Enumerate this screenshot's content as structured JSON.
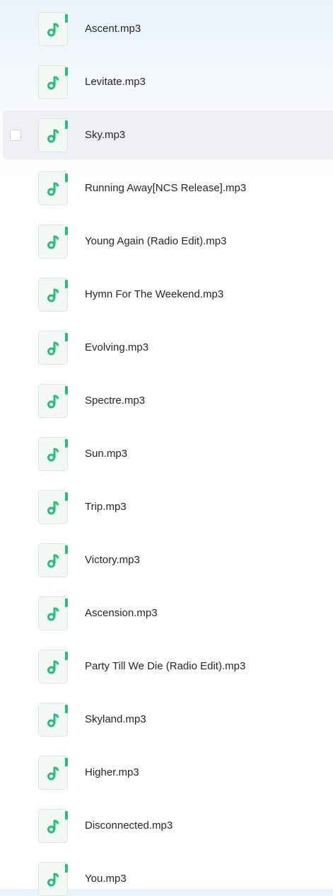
{
  "files": [
    {
      "name": "Ascent.mp3",
      "icon": "music-note-icon"
    },
    {
      "name": "Levitate.mp3",
      "icon": "music-note-icon"
    },
    {
      "name": "Sky.mp3",
      "icon": "music-note-icon",
      "hovered": true
    },
    {
      "name": "Running Away[NCS Release].mp3",
      "icon": "music-note-icon"
    },
    {
      "name": "Young Again (Radio Edit).mp3",
      "icon": "music-note-icon"
    },
    {
      "name": "Hymn For The Weekend.mp3",
      "icon": "music-note-icon"
    },
    {
      "name": "Evolving.mp3",
      "icon": "music-note-icon"
    },
    {
      "name": "Spectre.mp3",
      "icon": "music-note-icon"
    },
    {
      "name": "Sun.mp3",
      "icon": "music-note-icon"
    },
    {
      "name": "Trip.mp3",
      "icon": "music-note-icon"
    },
    {
      "name": "Victory.mp3",
      "icon": "music-note-icon"
    },
    {
      "name": "Ascension.mp3",
      "icon": "music-note-icon"
    },
    {
      "name": "Party Till We Die (Radio Edit).mp3",
      "icon": "music-note-icon"
    },
    {
      "name": "Skyland.mp3",
      "icon": "music-note-icon"
    },
    {
      "name": "Higher.mp3",
      "icon": "music-note-icon"
    },
    {
      "name": "Disconnected.mp3",
      "icon": "music-note-icon"
    },
    {
      "name": "You.mp3",
      "icon": "music-note-icon"
    }
  ],
  "colors": {
    "icon_accent": "#22c07a",
    "hover_row": "#eef0f3",
    "text": "#25262b"
  }
}
